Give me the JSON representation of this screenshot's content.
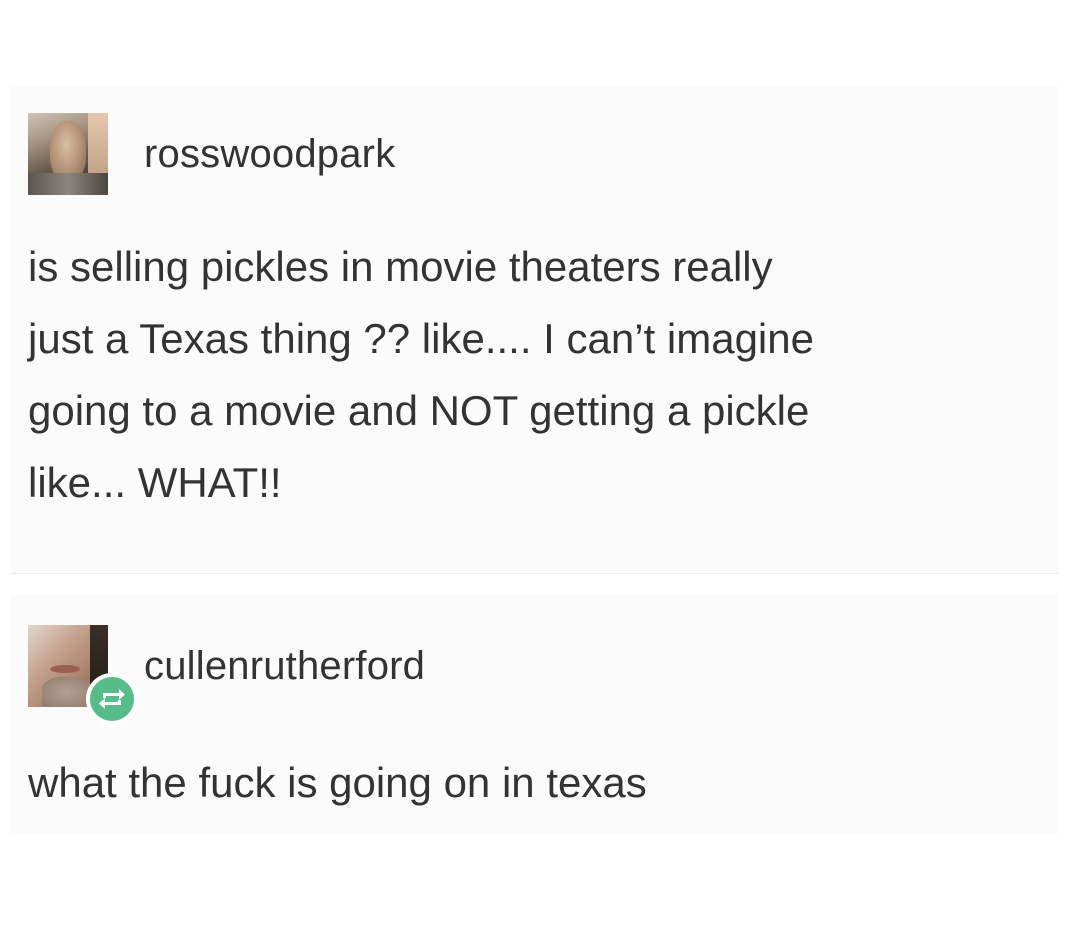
{
  "posts": [
    {
      "username": "rosswoodpark",
      "avatar_icon": "user-avatar-photo",
      "text_lines": [
        "is selling pickles in movie theaters really",
        "just a Texas thing ?? like.... I can’t imagine",
        "going to a movie and NOT getting a pickle",
        "like... WHAT!!"
      ]
    },
    {
      "username": "cullenrutherford",
      "avatar_icon": "user-avatar-photo",
      "badge_icon": "reblog-icon",
      "badge_color": "#56bc8a",
      "text_lines": [
        "what the fuck is going on in texas"
      ]
    }
  ]
}
